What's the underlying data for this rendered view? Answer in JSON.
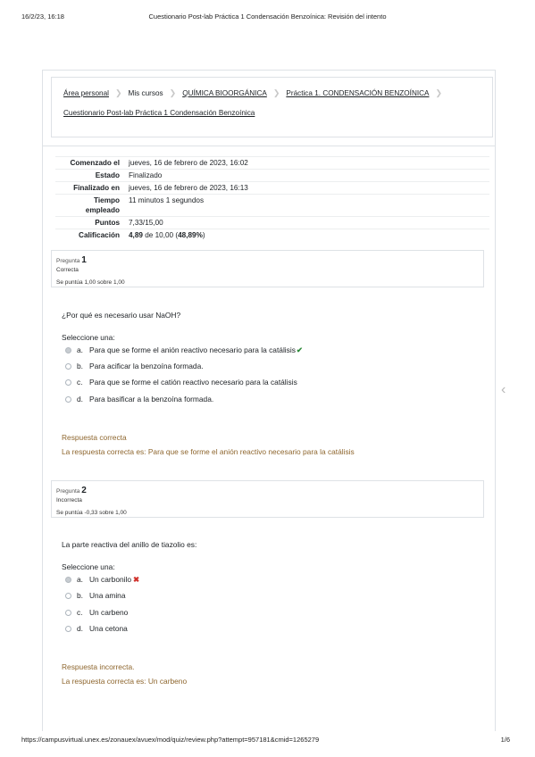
{
  "print": {
    "date": "16/2/23, 16:18",
    "title": "Cuestionario Post-lab Práctica 1 Condensación Benzoínica: Revisión del intento",
    "url": "https://campusvirtual.unex.es/zonauex/avuex/mod/quiz/review.php?attempt=957181&cmid=1265279",
    "page": "1/6"
  },
  "breadcrumb": {
    "items": [
      "Área personal",
      "Mis cursos",
      "QUÍMICA BIOORGÁNICA",
      "Práctica 1. CONDENSACIÓN BENZOÍNICA"
    ],
    "current": "Cuestionario Post-lab Práctica 1 Condensación Benzoínica"
  },
  "summary": {
    "started_label": "Comenzado el",
    "started_value": "jueves, 16 de febrero de 2023, 16:02",
    "state_label": "Estado",
    "state_value": "Finalizado",
    "finished_label": "Finalizado en",
    "finished_value": "jueves, 16 de febrero de 2023, 16:13",
    "time_label": "Tiempo empleado",
    "time_value": "11 minutos 1 segundos",
    "points_label": "Puntos",
    "points_value": "7,33/15,00",
    "grade_label": "Calificación",
    "grade_value_bold": "4,89",
    "grade_value_rest": " de 10,00 (",
    "grade_percent": "48,89%",
    "grade_close": ")"
  },
  "questions": [
    {
      "label": "Pregunta",
      "number": "1",
      "state": "Correcta",
      "mark": "Se puntúa 1,00 sobre 1,00",
      "text": "¿Por qué es necesario usar NaOH?",
      "prompt": "Seleccione una:",
      "options": [
        {
          "letter": "a.",
          "text": "Para que se forme el anión reactivo necesario para la catálisis",
          "selected": true,
          "mark": "✔"
        },
        {
          "letter": "b.",
          "text": "Para acificar la benzoína formada.",
          "selected": false
        },
        {
          "letter": "c.",
          "text": "Para que se forme el catión reactivo necesario para la catálisis",
          "selected": false
        },
        {
          "letter": "d.",
          "text": "Para basificar a la benzoína formada.",
          "selected": false
        }
      ],
      "feedback": "Respuesta correcta",
      "right_answer": "La respuesta correcta es: Para que se forme el anión reactivo necesario para la catálisis"
    },
    {
      "label": "Pregunta",
      "number": "2",
      "state": "Incorrecta",
      "mark": "Se puntúa -0,33 sobre 1,00",
      "text": "La parte reactiva del anillo de tiazolio es:",
      "prompt": "Seleccione una:",
      "options": [
        {
          "letter": "a.",
          "text": "Un carbonilo",
          "selected": true,
          "mark": "✖"
        },
        {
          "letter": "b.",
          "text": "Una amina",
          "selected": false
        },
        {
          "letter": "c.",
          "text": "Un carbeno",
          "selected": false
        },
        {
          "letter": "d.",
          "text": "Una cetona",
          "selected": false
        }
      ],
      "feedback": "Respuesta incorrecta.",
      "right_answer": "La respuesta correcta es: Un carbeno"
    }
  ],
  "colors": {
    "feedback": "#8e662e",
    "ok": "#2e8b3a",
    "bad": "#d0302a"
  }
}
